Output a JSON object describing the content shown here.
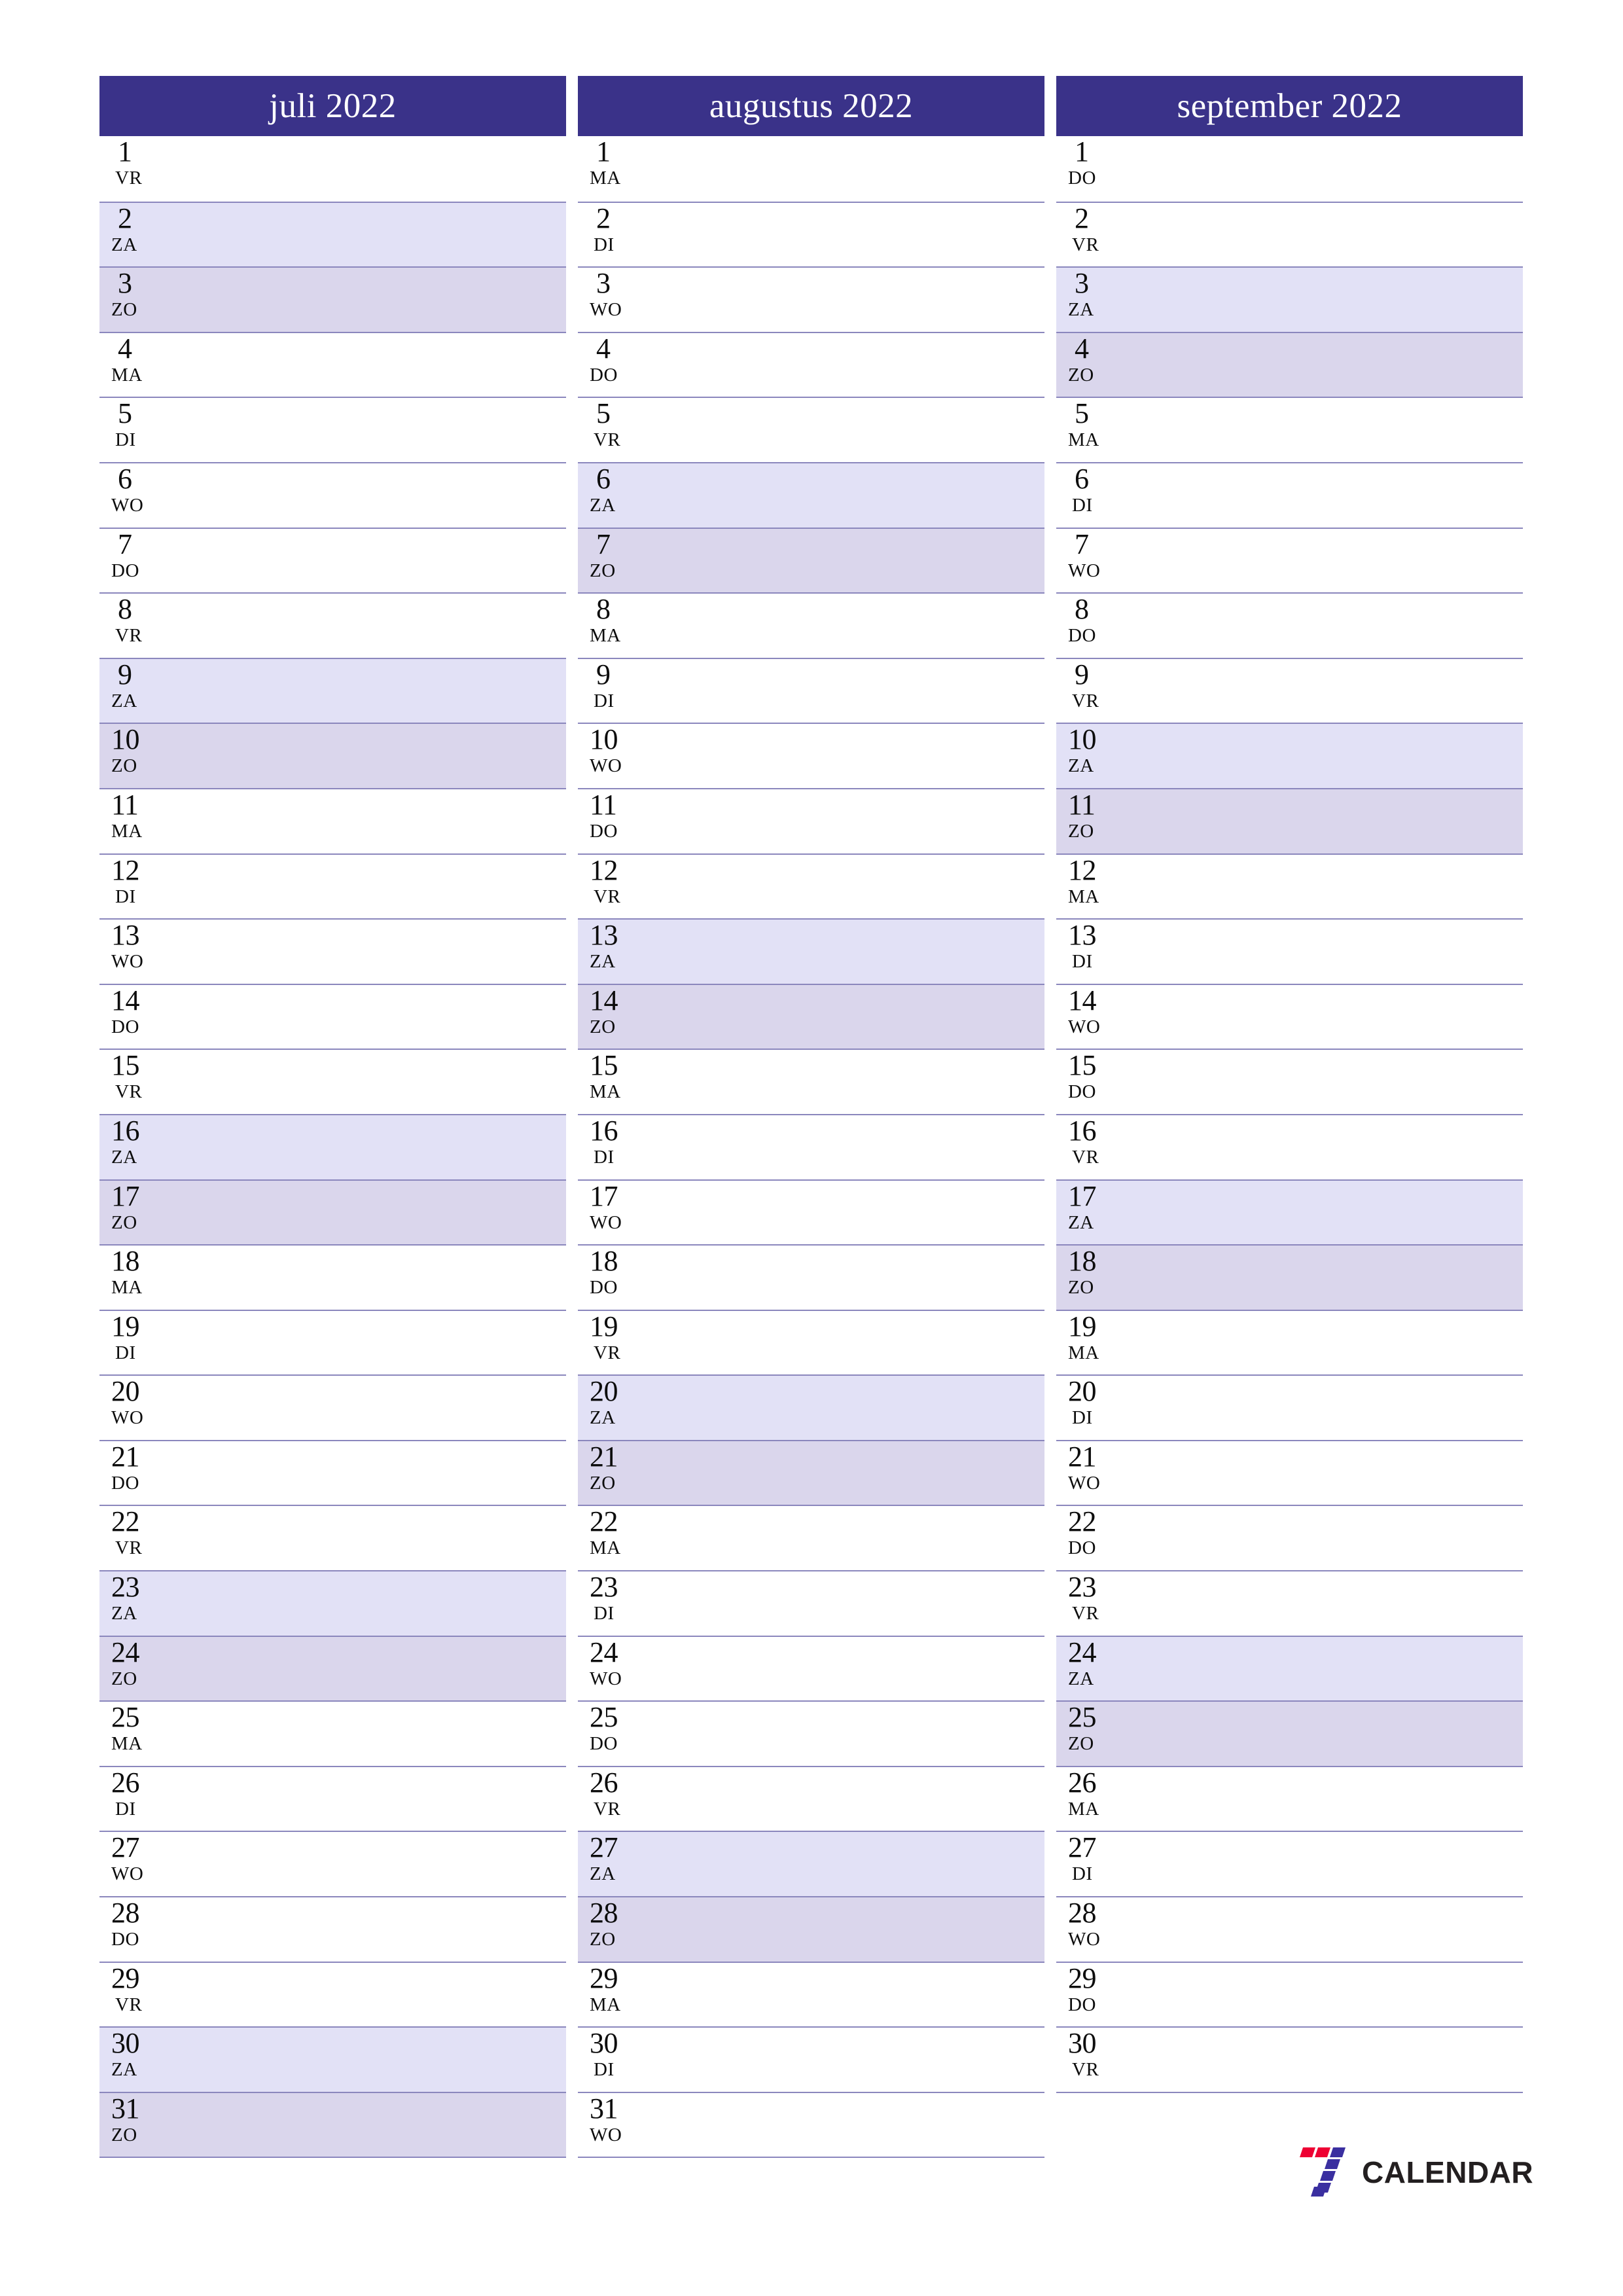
{
  "page": {
    "locale": "nl",
    "title": "juli augustus september 2022 kalender",
    "accent_color": "#3a3289",
    "saturday_color": "#e2e1f6",
    "sunday_color": "#dad6ec",
    "separator_color": "#8b87bd"
  },
  "brand": {
    "name": "CALENDAR",
    "mark": "seven-logo-icon",
    "mark_colors": [
      "#ee0033",
      "#3a2fa0"
    ]
  },
  "months": [
    {
      "title": "juli 2022",
      "days": [
        {
          "num": "1",
          "abbr": "VR",
          "type": "weekday"
        },
        {
          "num": "2",
          "abbr": "ZA",
          "type": "sat"
        },
        {
          "num": "3",
          "abbr": "ZO",
          "type": "sun"
        },
        {
          "num": "4",
          "abbr": "MA",
          "type": "weekday"
        },
        {
          "num": "5",
          "abbr": "DI",
          "type": "weekday"
        },
        {
          "num": "6",
          "abbr": "WO",
          "type": "weekday"
        },
        {
          "num": "7",
          "abbr": "DO",
          "type": "weekday"
        },
        {
          "num": "8",
          "abbr": "VR",
          "type": "weekday"
        },
        {
          "num": "9",
          "abbr": "ZA",
          "type": "sat"
        },
        {
          "num": "10",
          "abbr": "ZO",
          "type": "sun"
        },
        {
          "num": "11",
          "abbr": "MA",
          "type": "weekday"
        },
        {
          "num": "12",
          "abbr": "DI",
          "type": "weekday"
        },
        {
          "num": "13",
          "abbr": "WO",
          "type": "weekday"
        },
        {
          "num": "14",
          "abbr": "DO",
          "type": "weekday"
        },
        {
          "num": "15",
          "abbr": "VR",
          "type": "weekday"
        },
        {
          "num": "16",
          "abbr": "ZA",
          "type": "sat"
        },
        {
          "num": "17",
          "abbr": "ZO",
          "type": "sun"
        },
        {
          "num": "18",
          "abbr": "MA",
          "type": "weekday"
        },
        {
          "num": "19",
          "abbr": "DI",
          "type": "weekday"
        },
        {
          "num": "20",
          "abbr": "WO",
          "type": "weekday"
        },
        {
          "num": "21",
          "abbr": "DO",
          "type": "weekday"
        },
        {
          "num": "22",
          "abbr": "VR",
          "type": "weekday"
        },
        {
          "num": "23",
          "abbr": "ZA",
          "type": "sat"
        },
        {
          "num": "24",
          "abbr": "ZO",
          "type": "sun"
        },
        {
          "num": "25",
          "abbr": "MA",
          "type": "weekday"
        },
        {
          "num": "26",
          "abbr": "DI",
          "type": "weekday"
        },
        {
          "num": "27",
          "abbr": "WO",
          "type": "weekday"
        },
        {
          "num": "28",
          "abbr": "DO",
          "type": "weekday"
        },
        {
          "num": "29",
          "abbr": "VR",
          "type": "weekday"
        },
        {
          "num": "30",
          "abbr": "ZA",
          "type": "sat"
        },
        {
          "num": "31",
          "abbr": "ZO",
          "type": "sun"
        }
      ]
    },
    {
      "title": "augustus 2022",
      "days": [
        {
          "num": "1",
          "abbr": "MA",
          "type": "weekday"
        },
        {
          "num": "2",
          "abbr": "DI",
          "type": "weekday"
        },
        {
          "num": "3",
          "abbr": "WO",
          "type": "weekday"
        },
        {
          "num": "4",
          "abbr": "DO",
          "type": "weekday"
        },
        {
          "num": "5",
          "abbr": "VR",
          "type": "weekday"
        },
        {
          "num": "6",
          "abbr": "ZA",
          "type": "sat"
        },
        {
          "num": "7",
          "abbr": "ZO",
          "type": "sun"
        },
        {
          "num": "8",
          "abbr": "MA",
          "type": "weekday"
        },
        {
          "num": "9",
          "abbr": "DI",
          "type": "weekday"
        },
        {
          "num": "10",
          "abbr": "WO",
          "type": "weekday"
        },
        {
          "num": "11",
          "abbr": "DO",
          "type": "weekday"
        },
        {
          "num": "12",
          "abbr": "VR",
          "type": "weekday"
        },
        {
          "num": "13",
          "abbr": "ZA",
          "type": "sat"
        },
        {
          "num": "14",
          "abbr": "ZO",
          "type": "sun"
        },
        {
          "num": "15",
          "abbr": "MA",
          "type": "weekday"
        },
        {
          "num": "16",
          "abbr": "DI",
          "type": "weekday"
        },
        {
          "num": "17",
          "abbr": "WO",
          "type": "weekday"
        },
        {
          "num": "18",
          "abbr": "DO",
          "type": "weekday"
        },
        {
          "num": "19",
          "abbr": "VR",
          "type": "weekday"
        },
        {
          "num": "20",
          "abbr": "ZA",
          "type": "sat"
        },
        {
          "num": "21",
          "abbr": "ZO",
          "type": "sun"
        },
        {
          "num": "22",
          "abbr": "MA",
          "type": "weekday"
        },
        {
          "num": "23",
          "abbr": "DI",
          "type": "weekday"
        },
        {
          "num": "24",
          "abbr": "WO",
          "type": "weekday"
        },
        {
          "num": "25",
          "abbr": "DO",
          "type": "weekday"
        },
        {
          "num": "26",
          "abbr": "VR",
          "type": "weekday"
        },
        {
          "num": "27",
          "abbr": "ZA",
          "type": "sat"
        },
        {
          "num": "28",
          "abbr": "ZO",
          "type": "sun"
        },
        {
          "num": "29",
          "abbr": "MA",
          "type": "weekday"
        },
        {
          "num": "30",
          "abbr": "DI",
          "type": "weekday"
        },
        {
          "num": "31",
          "abbr": "WO",
          "type": "weekday"
        }
      ]
    },
    {
      "title": "september 2022",
      "days": [
        {
          "num": "1",
          "abbr": "DO",
          "type": "weekday"
        },
        {
          "num": "2",
          "abbr": "VR",
          "type": "weekday"
        },
        {
          "num": "3",
          "abbr": "ZA",
          "type": "sat"
        },
        {
          "num": "4",
          "abbr": "ZO",
          "type": "sun"
        },
        {
          "num": "5",
          "abbr": "MA",
          "type": "weekday"
        },
        {
          "num": "6",
          "abbr": "DI",
          "type": "weekday"
        },
        {
          "num": "7",
          "abbr": "WO",
          "type": "weekday"
        },
        {
          "num": "8",
          "abbr": "DO",
          "type": "weekday"
        },
        {
          "num": "9",
          "abbr": "VR",
          "type": "weekday"
        },
        {
          "num": "10",
          "abbr": "ZA",
          "type": "sat"
        },
        {
          "num": "11",
          "abbr": "ZO",
          "type": "sun"
        },
        {
          "num": "12",
          "abbr": "MA",
          "type": "weekday"
        },
        {
          "num": "13",
          "abbr": "DI",
          "type": "weekday"
        },
        {
          "num": "14",
          "abbr": "WO",
          "type": "weekday"
        },
        {
          "num": "15",
          "abbr": "DO",
          "type": "weekday"
        },
        {
          "num": "16",
          "abbr": "VR",
          "type": "weekday"
        },
        {
          "num": "17",
          "abbr": "ZA",
          "type": "sat"
        },
        {
          "num": "18",
          "abbr": "ZO",
          "type": "sun"
        },
        {
          "num": "19",
          "abbr": "MA",
          "type": "weekday"
        },
        {
          "num": "20",
          "abbr": "DI",
          "type": "weekday"
        },
        {
          "num": "21",
          "abbr": "WO",
          "type": "weekday"
        },
        {
          "num": "22",
          "abbr": "DO",
          "type": "weekday"
        },
        {
          "num": "23",
          "abbr": "VR",
          "type": "weekday"
        },
        {
          "num": "24",
          "abbr": "ZA",
          "type": "sat"
        },
        {
          "num": "25",
          "abbr": "ZO",
          "type": "sun"
        },
        {
          "num": "26",
          "abbr": "MA",
          "type": "weekday"
        },
        {
          "num": "27",
          "abbr": "DI",
          "type": "weekday"
        },
        {
          "num": "28",
          "abbr": "WO",
          "type": "weekday"
        },
        {
          "num": "29",
          "abbr": "DO",
          "type": "weekday"
        },
        {
          "num": "30",
          "abbr": "VR",
          "type": "weekday"
        }
      ]
    }
  ]
}
